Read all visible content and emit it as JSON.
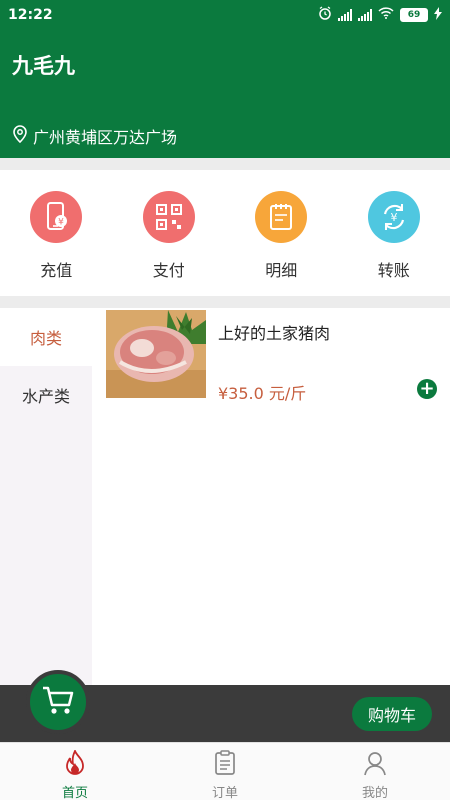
{
  "status_bar": {
    "time": "12:22",
    "battery": "69",
    "icons": [
      "alarm-icon",
      "signal-icon",
      "signal-icon",
      "wifi-icon",
      "battery-icon",
      "charging-icon"
    ]
  },
  "header": {
    "title": "九毛九",
    "location": "广州黄埔区万达广场",
    "location_icon": "location-pin-icon",
    "bg_color": "#0b7a3e"
  },
  "actions": [
    {
      "label": "充值",
      "icon": "recharge-phone-icon",
      "color": "#f06e6e"
    },
    {
      "label": "支付",
      "icon": "qr-pay-icon",
      "color": "#f06e6e"
    },
    {
      "label": "明细",
      "icon": "notepad-details-icon",
      "color": "#f7a63a"
    },
    {
      "label": "转账",
      "icon": "transfer-icon",
      "color": "#4fc7e0"
    }
  ],
  "categories": [
    {
      "label": "肉类",
      "active": true
    },
    {
      "label": "水产类",
      "active": false
    }
  ],
  "products": [
    {
      "name": "上好的土家猪肉",
      "price": "¥35.0 元/斤",
      "image": "pork-meat-photo",
      "add_icon": "add-circle-icon"
    }
  ],
  "cart": {
    "button_label": "购物车",
    "icon": "shopping-cart-icon"
  },
  "tabs": [
    {
      "label": "首页",
      "icon": "flame-home-icon",
      "active": true
    },
    {
      "label": "订单",
      "icon": "clipboard-order-icon",
      "active": false
    },
    {
      "label": "我的",
      "icon": "user-profile-icon",
      "active": false
    }
  ],
  "colors": {
    "brand": "#0b7a3e",
    "price": "#c65e3e",
    "cart_bar": "#3b3b3b"
  }
}
